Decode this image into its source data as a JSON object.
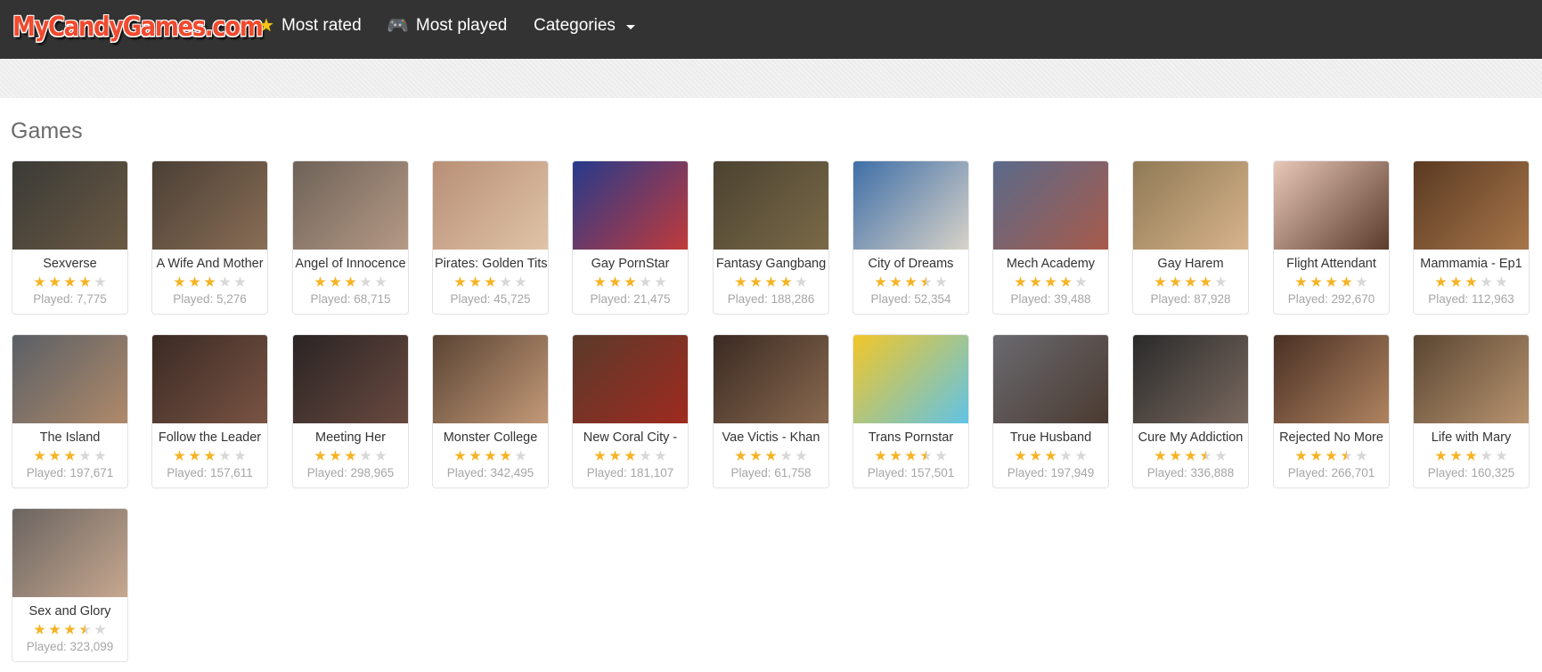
{
  "header": {
    "logo_text": "MyCandyGames.com",
    "nav": [
      {
        "label": "Most rated",
        "icon": "star-icon"
      },
      {
        "label": "Most played",
        "icon": "gamepad-icon"
      },
      {
        "label": "Categories",
        "icon": "caret-down-icon"
      }
    ]
  },
  "main": {
    "section_title": "Games"
  },
  "colors": {
    "navbar": "#333333",
    "star_filled": "#f6b324",
    "star_empty": "#d8d8d8",
    "played_text": "#a6a6a6"
  },
  "games": [
    {
      "title": "Sexverse",
      "rating": 4,
      "played": "Played: 7,775",
      "colors": [
        "#3a3a36",
        "#6b5a44"
      ]
    },
    {
      "title": "A Wife And Mother",
      "rating": 3,
      "played": "Played: 5,276",
      "colors": [
        "#4a3f35",
        "#8a6e56"
      ]
    },
    {
      "title": "Angel of Innocence",
      "rating": 3,
      "played": "Played: 68,715",
      "colors": [
        "#6e6258",
        "#b69a86"
      ]
    },
    {
      "title": "Pirates: Golden Tits",
      "rating": 3,
      "played": "Played: 45,725",
      "colors": [
        "#b88f76",
        "#e0c4a8"
      ]
    },
    {
      "title": "Gay PornStar",
      "rating": 3,
      "played": "Played: 21,475",
      "colors": [
        "#263a8c",
        "#c23a3a"
      ]
    },
    {
      "title": "Fantasy Gangbang",
      "rating": 4,
      "played": "Played: 188,286",
      "colors": [
        "#4b4230",
        "#7a6a48"
      ]
    },
    {
      "title": "City of Dreams",
      "rating": 3.5,
      "played": "Played: 52,354",
      "colors": [
        "#3f6fa8",
        "#d9d3c8"
      ]
    },
    {
      "title": "Mech Academy",
      "rating": 4,
      "played": "Played: 39,488",
      "colors": [
        "#5a6a8a",
        "#a85a4a"
      ]
    },
    {
      "title": "Gay Harem",
      "rating": 4,
      "played": "Played: 87,928",
      "colors": [
        "#8f7a55",
        "#d8b48c"
      ]
    },
    {
      "title": "Flight Attendant",
      "rating": 4,
      "played": "Played: 292,670",
      "colors": [
        "#e8c7b8",
        "#5a3a2a"
      ]
    },
    {
      "title": "Mammamia - Ep1",
      "rating": 3,
      "played": "Played: 112,963",
      "colors": [
        "#5a3a22",
        "#a8764a"
      ]
    },
    {
      "title": "The Island",
      "rating": 3,
      "played": "Played: 197,671",
      "colors": [
        "#5a5f66",
        "#b08a6a"
      ]
    },
    {
      "title": "Follow the Leader",
      "rating": 3,
      "played": "Played: 157,611",
      "colors": [
        "#3a2a24",
        "#7a5444"
      ]
    },
    {
      "title": "Meeting Her",
      "rating": 3,
      "played": "Played: 298,965",
      "colors": [
        "#2a2424",
        "#6a4a40"
      ]
    },
    {
      "title": "Monster College",
      "rating": 4,
      "played": "Played: 342,495",
      "colors": [
        "#5a4434",
        "#c49a78"
      ]
    },
    {
      "title": "New Coral City -",
      "rating": 3,
      "played": "Played: 181,107",
      "colors": [
        "#5a3a2a",
        "#a02a20"
      ]
    },
    {
      "title": "Vae Victis - Khan",
      "rating": 3,
      "played": "Played: 61,758",
      "colors": [
        "#3a2a22",
        "#8a6a50"
      ]
    },
    {
      "title": "Trans Pornstar",
      "rating": 3.5,
      "played": "Played: 157,501",
      "colors": [
        "#f2c628",
        "#5fc4e8"
      ]
    },
    {
      "title": "True Husband",
      "rating": 3,
      "played": "Played: 197,949",
      "colors": [
        "#6a6a70",
        "#4a3a30"
      ]
    },
    {
      "title": "Cure My Addiction",
      "rating": 3.5,
      "played": "Played: 336,888",
      "colors": [
        "#2a2a2a",
        "#7a6a60"
      ]
    },
    {
      "title": "Rejected No More",
      "rating": 3.5,
      "played": "Played: 266,701",
      "colors": [
        "#4a3024",
        "#b08460"
      ]
    },
    {
      "title": "Life with Mary",
      "rating": 3,
      "played": "Played: 160,325",
      "colors": [
        "#5a4632",
        "#b89470"
      ]
    },
    {
      "title": "Sex and Glory",
      "rating": 3.5,
      "played": "Played: 323,099",
      "colors": [
        "#6a6460",
        "#c8a890"
      ]
    }
  ]
}
